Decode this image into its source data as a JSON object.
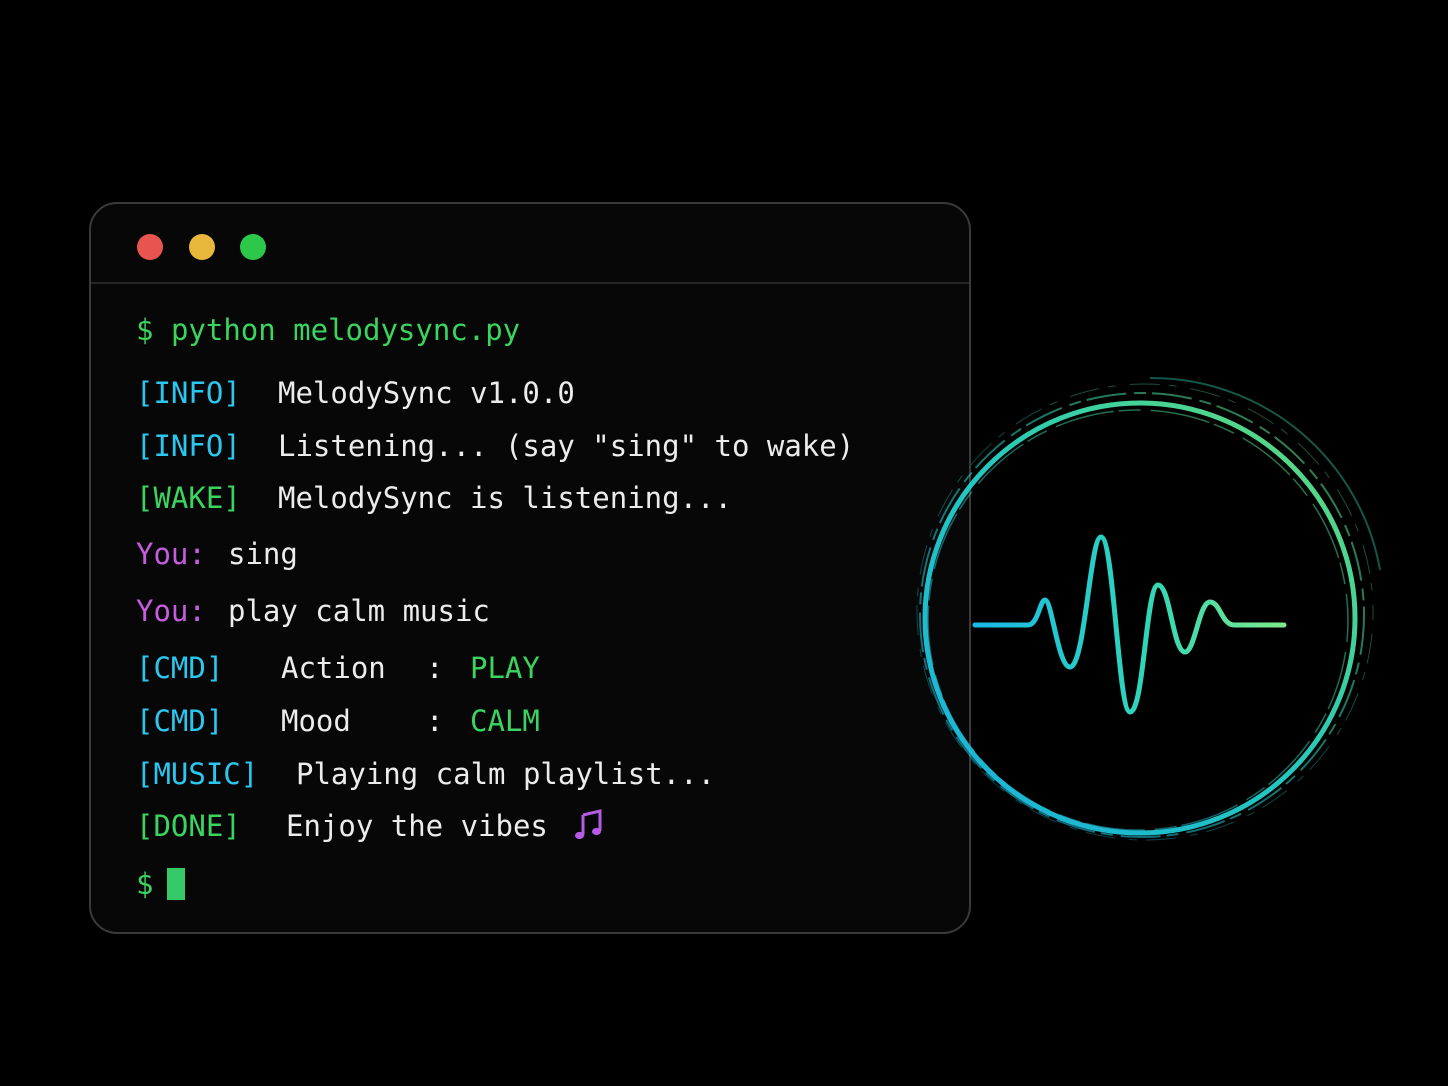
{
  "window": {
    "controls": [
      {
        "name": "close",
        "color": "#e8554e"
      },
      {
        "name": "minimize",
        "color": "#e8b83c"
      },
      {
        "name": "maximize",
        "color": "#2cc84a"
      }
    ]
  },
  "terminal": {
    "command": {
      "prompt": "$",
      "text": "python melodysync.py"
    },
    "lines": [
      {
        "tag": "[INFO]",
        "text": "MelodySync v1.0.0"
      },
      {
        "tag": "[INFO]",
        "text": "Listening... (say \"sing\" to wake)"
      },
      {
        "tag": "[WAKE]",
        "text": "MelodySync is listening..."
      },
      {
        "tag": "You:",
        "text": "sing"
      },
      {
        "tag": "You:",
        "text": "play calm music"
      },
      {
        "tag": "[CMD]",
        "label": "Action",
        "sep": ":",
        "value": "PLAY"
      },
      {
        "tag": "[CMD]",
        "label": "Mood",
        "sep": ":",
        "value": "CALM"
      },
      {
        "tag": "[MUSIC]",
        "text": "Playing calm playlist..."
      },
      {
        "tag": "[DONE]",
        "text": "Enjoy the vibes",
        "icon": "music-note-icon"
      }
    ],
    "final_prompt": "$"
  },
  "colors": {
    "info": "#2bc7ee",
    "success": "#3ad45f",
    "user": "#c65ce0",
    "text": "#ececec"
  },
  "icons": {
    "music": "music-note-icon",
    "wave": "sound-wave-icon"
  }
}
